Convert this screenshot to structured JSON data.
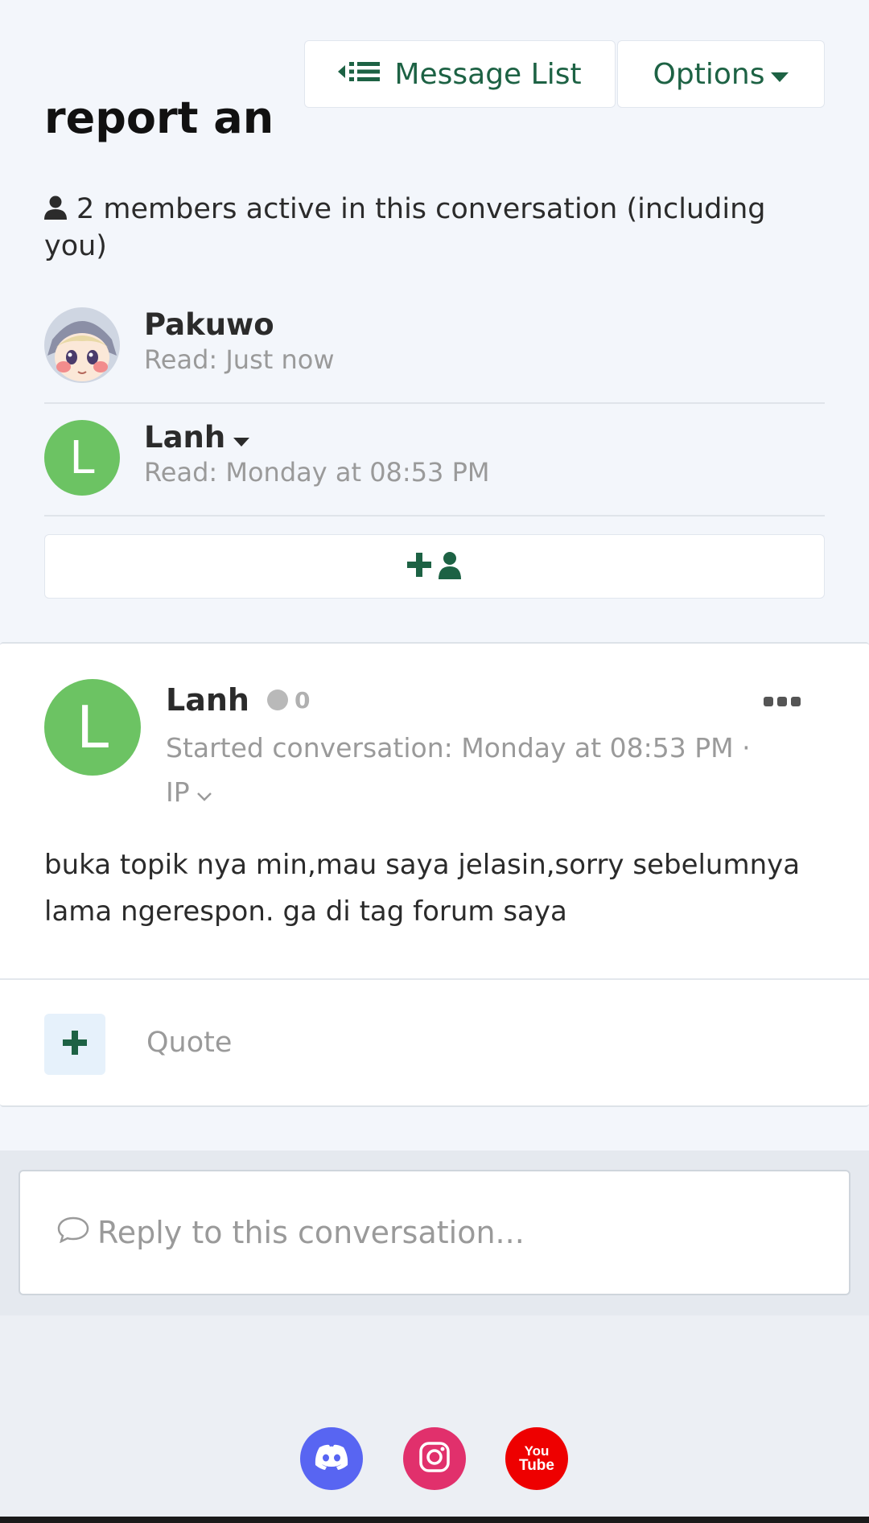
{
  "header": {
    "message_list_label": "Message List",
    "options_label": "Options",
    "title": "report an"
  },
  "members": {
    "summary": "2 members active in this conversation (including you)",
    "list": [
      {
        "name": "Pakuwo",
        "read": "Read: Just now",
        "avatar": "anime-girl-avatar"
      },
      {
        "name": "Lanh",
        "read": "Read: Monday at 08:53 PM",
        "avatar_letter": "L"
      }
    ]
  },
  "post": {
    "author": "Lanh",
    "avatar_letter": "L",
    "reaction_count": "0",
    "meta": "Started conversation: Monday at 08:53 PM ·",
    "ip_label": "IP",
    "body": "buka topik nya min,mau saya jelasin,sorry sebelumnya lama ngerespon. ga di tag forum saya",
    "quote_label": "Quote"
  },
  "reply": {
    "placeholder": "Reply to this conversation..."
  },
  "footer": {
    "youtube_top": "You",
    "youtube_bottom": "Tube"
  },
  "colors": {
    "accent": "#1d6244",
    "avatar_green": "#6cc363",
    "discord": "#5865f2",
    "instagram": "#e1306c",
    "youtube": "#ee0000"
  },
  "icons": [
    "back-list-icon",
    "caret-down-icon",
    "user-icon",
    "add-user-icon",
    "status-dot-icon",
    "more-icon",
    "chevron-down-icon",
    "plus-icon",
    "comment-icon",
    "discord-icon",
    "instagram-icon",
    "youtube-icon"
  ]
}
